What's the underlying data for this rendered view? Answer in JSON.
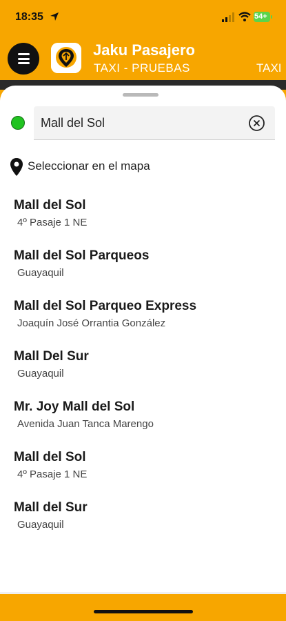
{
  "status_bar": {
    "time": "18:35",
    "battery": "54+"
  },
  "header": {
    "title": "Jaku Pasajero",
    "subtitle": "TAXI - PRUEBAS",
    "subtitle_overflow": "TAXI"
  },
  "search": {
    "value": "Mall del Sol"
  },
  "map_select": {
    "label": "Seleccionar en el mapa"
  },
  "results": [
    {
      "title": "Mall del Sol",
      "subtitle": "4º Pasaje 1 NE"
    },
    {
      "title": "Mall del Sol Parqueos",
      "subtitle": "Guayaquil"
    },
    {
      "title": "Mall del Sol Parqueo Express",
      "subtitle": "Joaquín José Orrantia González"
    },
    {
      "title": "Mall Del Sur",
      "subtitle": "Guayaquil"
    },
    {
      "title": "Mr. Joy Mall del Sol",
      "subtitle": "Avenida Juan Tanca Marengo"
    },
    {
      "title": "Mall del Sol",
      "subtitle": "4º Pasaje 1 NE"
    },
    {
      "title": "Mall del Sur",
      "subtitle": "Guayaquil"
    }
  ],
  "colors": {
    "brand": "#F7A600",
    "origin_dot": "#21C321"
  }
}
